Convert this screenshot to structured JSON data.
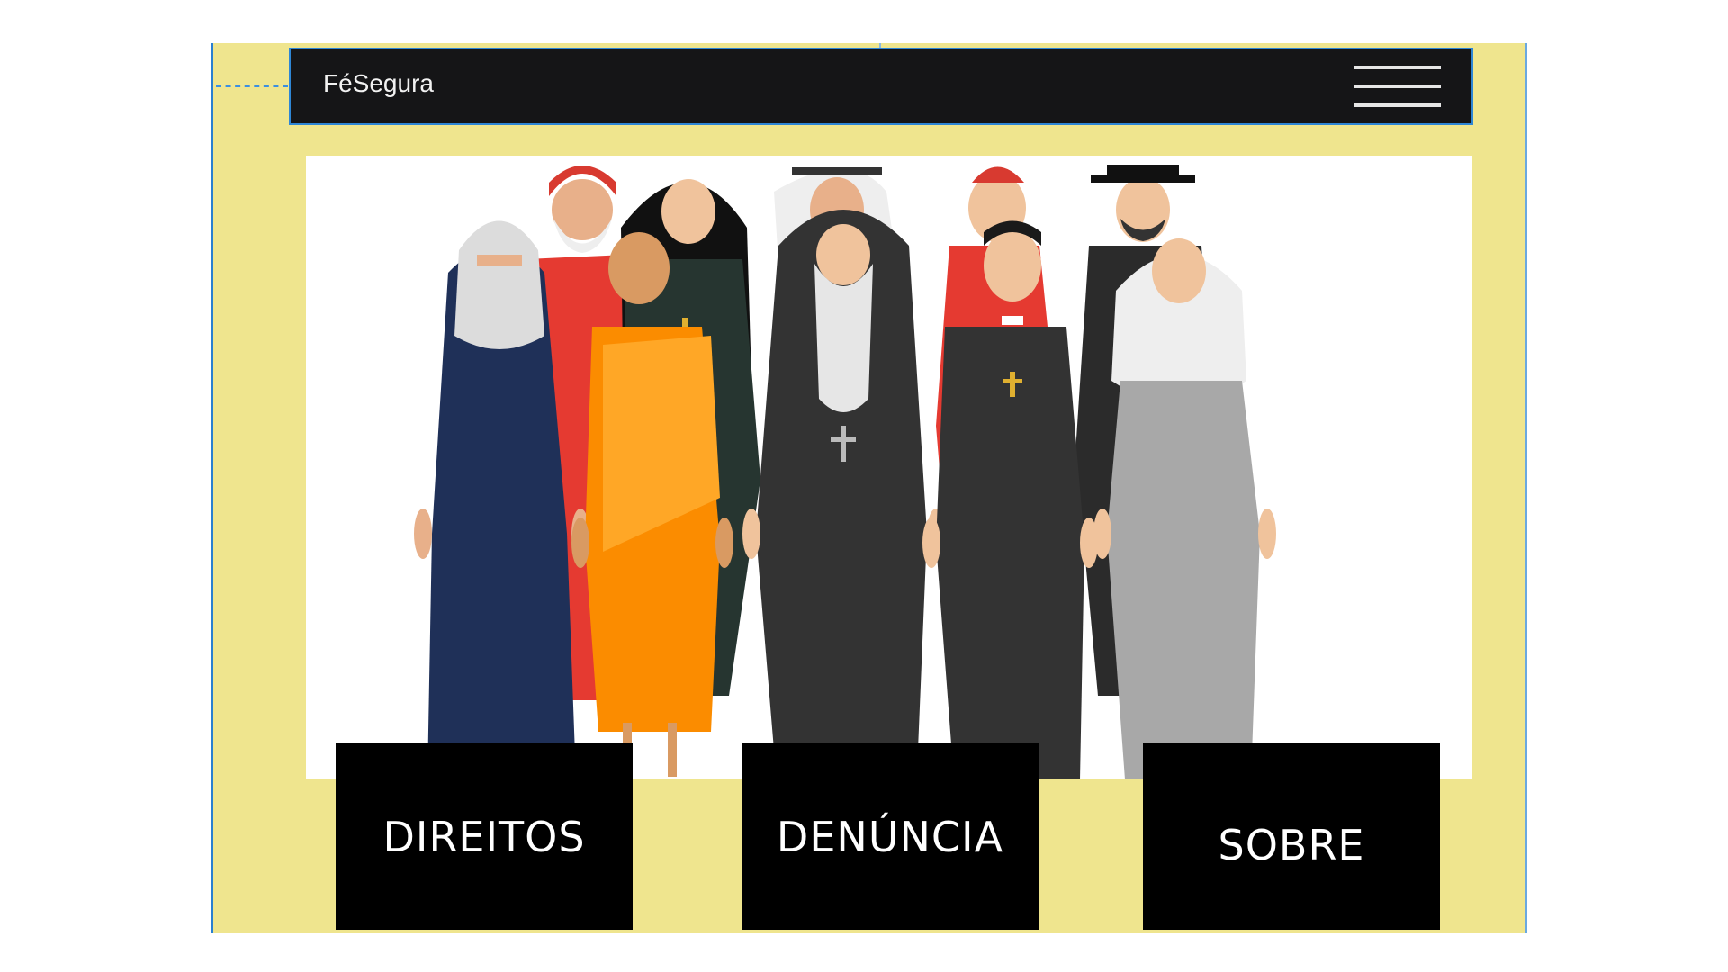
{
  "navbar": {
    "brand": "FéSegura",
    "menu_icon": "hamburger-menu-icon"
  },
  "hero": {
    "illustration": "religious-people-group-illustration"
  },
  "tiles": [
    {
      "label": "DIREITOS"
    },
    {
      "label": "DENÚNCIA"
    },
    {
      "label": "SOBRE"
    }
  ],
  "colors": {
    "page_background": "#efe58e",
    "navbar_background": "#151517",
    "tile_background": "#000000",
    "tile_text": "#ffffff"
  }
}
